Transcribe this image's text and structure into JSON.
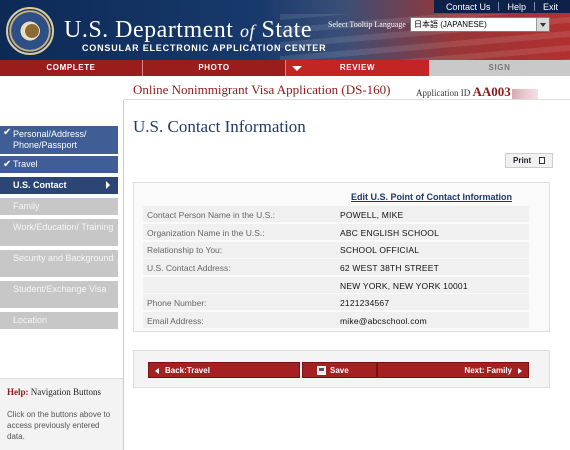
{
  "header": {
    "dept_title_part1": "U.S. Department",
    "dept_title_of": "of",
    "dept_title_part2": "State",
    "subtitle": "CONSULAR ELECTRONIC APPLICATION CENTER",
    "topnav": [
      "Contact Us",
      "Help",
      "Exit"
    ],
    "language_label": "Select Tooltip Language",
    "language_value": "日本語 (JAPANESE)"
  },
  "progress": {
    "steps": [
      "COMPLETE",
      "PHOTO",
      "REVIEW",
      "SIGN"
    ],
    "current": "REVIEW"
  },
  "app": {
    "title": "Online Nonimmigrant Visa Application (DS-160)",
    "id_label": "Application ID",
    "id_value": "AA003"
  },
  "sidebar": {
    "items": [
      {
        "label": "Personal/Address/ Phone/Passport",
        "state": "done"
      },
      {
        "label": "Travel",
        "state": "done"
      },
      {
        "label": "U.S. Contact",
        "state": "current"
      },
      {
        "label": "Family",
        "state": "todo"
      },
      {
        "label": "Work/Education/ Training",
        "state": "todo"
      },
      {
        "label": "Security and Background",
        "state": "todo"
      },
      {
        "label": "Student/Exchange Visa",
        "state": "todo"
      },
      {
        "label": "Location",
        "state": "todo"
      }
    ],
    "help_prefix": "Help:",
    "help_title": "Navigation Buttons",
    "help_body": "Click on the buttons above to access previously entered data."
  },
  "main": {
    "page_title": "U.S. Contact Information",
    "print_label": "Print",
    "edit_link": "Edit U.S. Point of Contact Information",
    "rows": [
      {
        "label": "Contact Person Name in the U.S.:",
        "value": "POWELL, MIKE"
      },
      {
        "label": "Organization Name in the U.S.:",
        "value": "ABC ENGLISH SCHOOL"
      },
      {
        "label": "Relationship to You:",
        "value": "SCHOOL OFFICIAL"
      },
      {
        "label": "U.S. Contact Address:",
        "value": "62 WEST 38TH STREET"
      },
      {
        "label": "",
        "value": "NEW YORK, NEW YORK 10001"
      },
      {
        "label": "Phone Number:",
        "value": "2121234567"
      },
      {
        "label": "Email Address:",
        "value": "mike@abcschool.com"
      }
    ]
  },
  "buttons": {
    "back": "Back:Travel",
    "save": "Save",
    "next": "Next: Family"
  }
}
